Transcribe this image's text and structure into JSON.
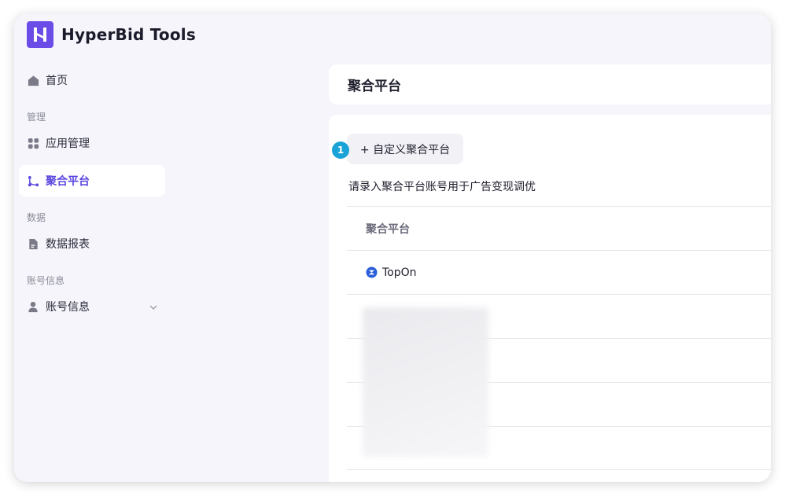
{
  "app": {
    "title": "HyperBid Tools",
    "brand_color": "#6c4ce6",
    "accent": "#5b47e0"
  },
  "sidebar": {
    "home": "首页",
    "groups": [
      "管理",
      "数据",
      "账号信息"
    ],
    "items": [
      {
        "label": "应用管理",
        "icon": "apps-grid-icon"
      },
      {
        "label": "聚合平台",
        "icon": "branch-icon",
        "active": true
      },
      {
        "label": "数据报表",
        "icon": "document-icon"
      },
      {
        "label": "账号信息",
        "icon": "user-icon"
      }
    ]
  },
  "page": {
    "title": "聚合平台",
    "add_button": "+ 自定义聚合平台",
    "step_badge": "1",
    "description": "请录入聚合平台账号用于广告变现调优"
  },
  "table": {
    "header": "聚合平台",
    "rows": [
      "TopOn"
    ]
  }
}
